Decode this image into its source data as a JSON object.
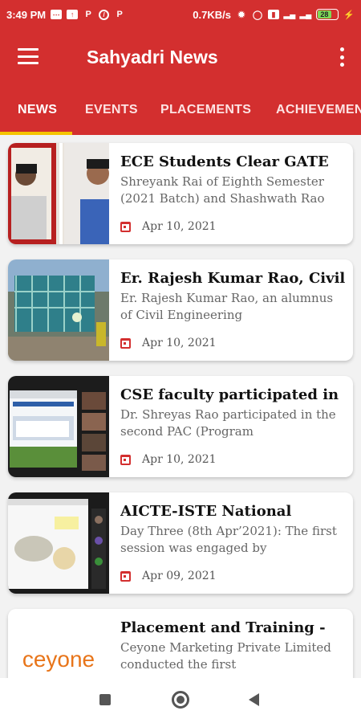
{
  "status_bar": {
    "time": "3:49 PM",
    "network_speed": "0.7KB/s",
    "battery_level": "28",
    "icons": [
      "message-icon",
      "upload-icon",
      "p-icon",
      "dnd-icon",
      "p-icon",
      "settings-icon",
      "alarm-icon",
      "vibrate-icon",
      "signal-icon",
      "signal-icon",
      "battery-icon",
      "charging-icon"
    ]
  },
  "app_bar": {
    "title": "Sahyadri News",
    "menu_icon": "hamburger-menu-icon",
    "more_icon": "more-vert-icon"
  },
  "tabs": [
    {
      "label": "NEWS",
      "active": true
    },
    {
      "label": "EVENTS",
      "active": false
    },
    {
      "label": "PLACEMENTS",
      "active": false
    },
    {
      "label": "ACHIEVEMENTS",
      "active": false
    }
  ],
  "colors": {
    "primary": "#d32f2f",
    "indicator": "#f5c400",
    "ceyone_orange": "#e8751a"
  },
  "news": [
    {
      "title": "ECE Students Clear GATE",
      "desc": "Shreyank Rai of Eighth Semester (2021 Batch) and Shashwath Rao",
      "date": "Apr 10,  2021"
    },
    {
      "title": "Er. Rajesh Kumar Rao, Civil",
      "desc": "Er. Rajesh Kumar Rao, an alumnus of Civil Engineering",
      "date": "Apr 10,  2021"
    },
    {
      "title": "CSE faculty participated in",
      "desc": "Dr. Shreyas Rao participated in the second PAC (Program",
      "date": "Apr 10,  2021"
    },
    {
      "title": "AICTE-ISTE National",
      "desc": "Day Three (8th Apr’2021): The first session was engaged by",
      "date": "Apr 09,  2021"
    },
    {
      "title": "Placement and Training -",
      "desc": "Ceyone Marketing Private Limited conducted the first",
      "date": "",
      "logo_text": "ceyone"
    }
  ],
  "nav_bar": {
    "icons": [
      "recents-square-icon",
      "home-circle-icon",
      "back-triangle-icon"
    ]
  }
}
